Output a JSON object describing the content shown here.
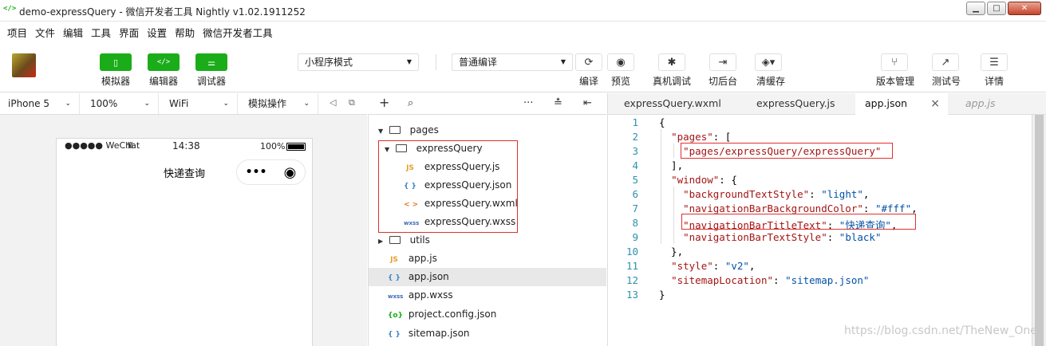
{
  "window": {
    "title": "demo-expressQuery - 微信开发者工具 Nightly v1.02.1911252",
    "logo": "</>"
  },
  "menu": [
    "项目",
    "文件",
    "编辑",
    "工具",
    "界面",
    "设置",
    "帮助",
    "微信开发者工具"
  ],
  "toolbar": {
    "simulator_label": "模拟器",
    "editor_label": "编辑器",
    "debugger_label": "调试器",
    "mode_select": "小程序模式",
    "compile_select": "普通编译",
    "compile_label": "编译",
    "preview_label": "预览",
    "real_debug_label": "真机调试",
    "background_label": "切后台",
    "clear_cache_label": "清缓存",
    "version_label": "版本管理",
    "test_label": "测试号",
    "details_label": "详情"
  },
  "simbar": {
    "device": "iPhone 5",
    "zoom": "100%",
    "network": "WiFi",
    "operation": "模拟操作"
  },
  "phone": {
    "carrier": "●●●●● WeChat",
    "time": "14:38",
    "battery": "100%",
    "nav_title": "快递查询",
    "capsule_more": "•••",
    "capsule_close": "◉"
  },
  "tree": {
    "nodes": [
      {
        "label": "pages",
        "type": "folder",
        "open": true
      },
      {
        "label": "expressQuery",
        "type": "folder",
        "open": true
      },
      {
        "label": "expressQuery.js",
        "type": "js",
        "badge": "JS"
      },
      {
        "label": "expressQuery.json",
        "type": "json",
        "badge": "{ }"
      },
      {
        "label": "expressQuery.wxml",
        "type": "wxml",
        "badge": "< >"
      },
      {
        "label": "expressQuery.wxss",
        "type": "wxss",
        "badge": "wxss"
      },
      {
        "label": "utils",
        "type": "folder",
        "open": false
      },
      {
        "label": "app.js",
        "type": "js",
        "badge": "JS"
      },
      {
        "label": "app.json",
        "type": "json",
        "badge": "{ }",
        "selected": true
      },
      {
        "label": "app.wxss",
        "type": "wxss",
        "badge": "wxss"
      },
      {
        "label": "project.config.json",
        "type": "config",
        "badge": "{o}"
      },
      {
        "label": "sitemap.json",
        "type": "json",
        "badge": "{ }"
      }
    ]
  },
  "tabs": [
    {
      "label": "expressQuery.wxml"
    },
    {
      "label": "expressQuery.js"
    },
    {
      "label": "app.json",
      "active": true,
      "close": "×"
    },
    {
      "label": "app.js",
      "ghost": true
    }
  ],
  "editor": {
    "lines": [
      {
        "n": "1",
        "code": "{"
      },
      {
        "n": "2",
        "code": "  \"pages\": ["
      },
      {
        "n": "3",
        "code": "    \"pages/expressQuery/expressQuery\""
      },
      {
        "n": "4",
        "code": "  ],"
      },
      {
        "n": "5",
        "code": "  \"window\": {"
      },
      {
        "n": "6",
        "code": "    \"backgroundTextStyle\": \"light\","
      },
      {
        "n": "7",
        "code": "    \"navigationBarBackgroundColor\": \"#fff\","
      },
      {
        "n": "8",
        "code": "    \"navigationBarTitleText\": \"快递查询\","
      },
      {
        "n": "9",
        "code": "    \"navigationBarTextStyle\": \"black\""
      },
      {
        "n": "10",
        "code": "  },"
      },
      {
        "n": "11",
        "code": "  \"style\": \"v2\","
      },
      {
        "n": "12",
        "code": "  \"sitemapLocation\": \"sitemap.json\""
      },
      {
        "n": "13",
        "code": "}"
      }
    ]
  },
  "watermark": "https://blog.csdn.net/TheNew_One",
  "colors": {
    "green": "#1aad19",
    "highlight_red": "#e0312d",
    "line_number": "#2b91af",
    "json_key": "#a31515",
    "json_value": "#0451a5"
  }
}
